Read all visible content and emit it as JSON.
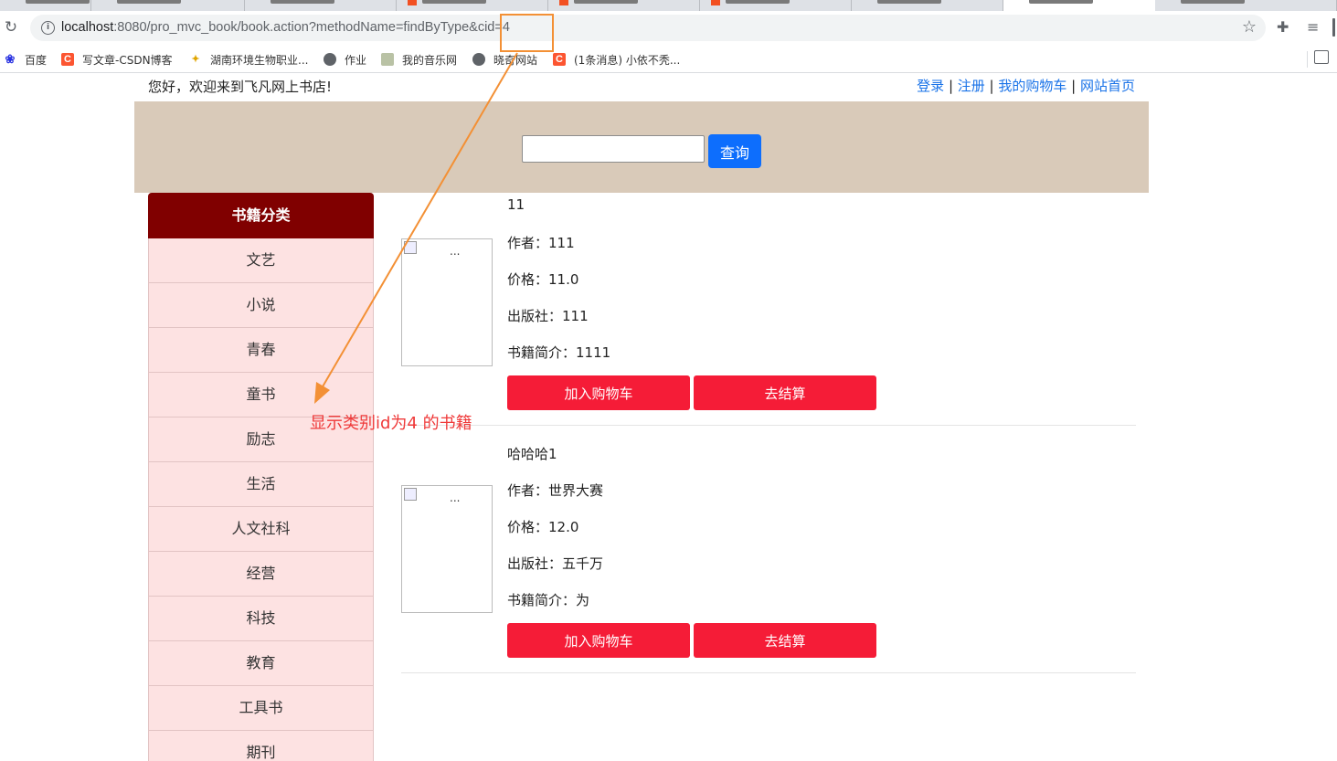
{
  "browser": {
    "url_host": "localhost",
    "url_rest": ":8080/pro_mvc_book/book.action?methodName=findByType&cid=4",
    "bookmarks": [
      {
        "label": "百度",
        "icon": "baidu-icon"
      },
      {
        "label": "写文章-CSDN博客",
        "icon": "csdn-icon"
      },
      {
        "label": "湖南环境生物职业...",
        "icon": "star-icon"
      },
      {
        "label": "作业",
        "icon": "globe-icon"
      },
      {
        "label": "我的音乐网",
        "icon": "image-icon"
      },
      {
        "label": "晓奇网站",
        "icon": "globe-icon"
      },
      {
        "label": "(1条消息) 小依不秃...",
        "icon": "csdn-icon"
      }
    ]
  },
  "header": {
    "welcome": "您好，欢迎来到飞凡网上书店!",
    "links": [
      "登录",
      "注册",
      "我的购物车",
      "网站首页"
    ],
    "separator": " | "
  },
  "search": {
    "value": "",
    "button_label": "查询"
  },
  "category": {
    "title": "书籍分类",
    "items": [
      "文艺",
      "小说",
      "青春",
      "童书",
      "励志",
      "生活",
      "人文社科",
      "经营",
      "科技",
      "教育",
      "工具书",
      "期刊"
    ]
  },
  "books": [
    {
      "title": "11",
      "author_label": "作者：",
      "author": "111",
      "price_label": "价格：",
      "price": "11.0",
      "publisher_label": "出版社：",
      "publisher": "111",
      "intro_label": "书籍简介：",
      "intro": "1111",
      "cover_alt": "...",
      "add_cart_label": "加入购物车",
      "checkout_label": "去结算"
    },
    {
      "title": "哈哈哈1",
      "author_label": "作者：",
      "author": "世界大赛",
      "price_label": "价格：",
      "price": "12.0",
      "publisher_label": "出版社：",
      "publisher": "五千万",
      "intro_label": "书籍简介：",
      "intro": "为",
      "cover_alt": "...",
      "add_cart_label": "加入购物车",
      "checkout_label": "去结算"
    }
  ],
  "annotation": {
    "text": "显示类别id为4 的书籍",
    "color": "#ef3a3a",
    "arrow_color": "#f39035"
  }
}
